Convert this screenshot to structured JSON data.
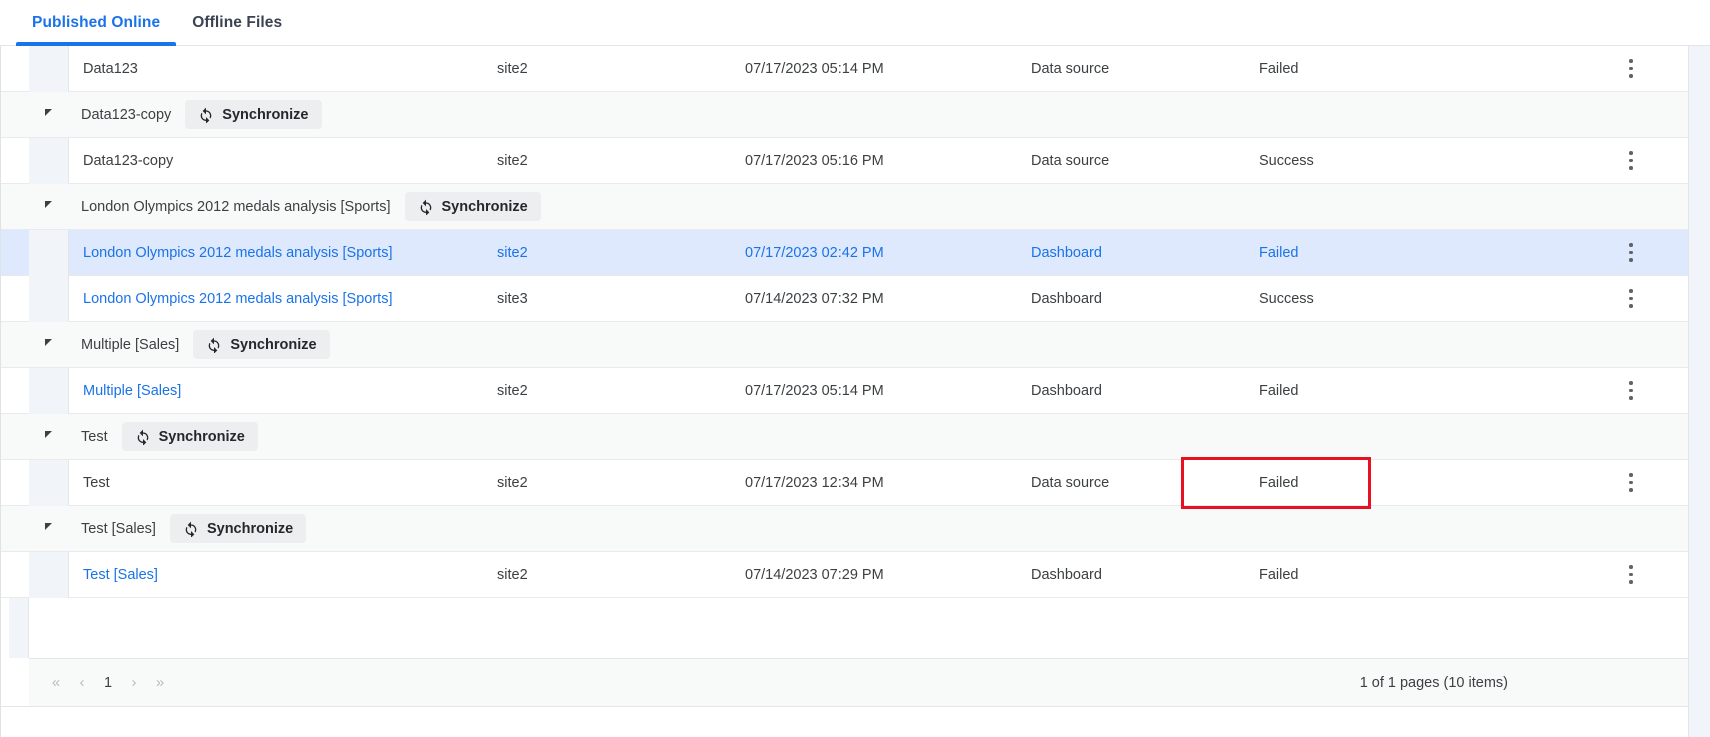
{
  "tabs": [
    {
      "label": "Published Online",
      "active": true
    },
    {
      "label": "Offline Files",
      "active": false
    }
  ],
  "colors": {
    "accent": "#1a73e8",
    "selected_row_bg": "#dee9fd",
    "group_header_bg": "#f8f9f9",
    "annotation_red": "#e81123",
    "text": "#3c4043"
  },
  "sync_button_label": "Synchronize",
  "icons": {
    "expander": "triangle-collapse-icon",
    "sync": "refresh-sync-icon",
    "kebab": "more-vertical-icon",
    "first_page": "chevron-double-left-icon",
    "prev_page": "chevron-left-icon",
    "next_page": "chevron-right-icon",
    "last_page": "chevron-double-right-icon"
  },
  "groups": [
    {
      "header": null,
      "rows": [
        {
          "name": "Data123",
          "name_is_link": false,
          "site": "site2",
          "timestamp": "07/17/2023 05:14 PM",
          "type": "Data source",
          "status": "Failed",
          "selected": false,
          "annotated": false
        }
      ]
    },
    {
      "header": {
        "label": "Data123-copy",
        "sync_label": "Synchronize"
      },
      "rows": [
        {
          "name": "Data123-copy",
          "name_is_link": false,
          "site": "site2",
          "timestamp": "07/17/2023 05:16 PM",
          "type": "Data source",
          "status": "Success",
          "selected": false,
          "annotated": false
        }
      ]
    },
    {
      "header": {
        "label": "London Olympics 2012 medals analysis [Sports]",
        "sync_label": "Synchronize"
      },
      "rows": [
        {
          "name": "London Olympics 2012 medals analysis [Sports]",
          "name_is_link": true,
          "site": "site2",
          "timestamp": "07/17/2023 02:42 PM",
          "type": "Dashboard",
          "status": "Failed",
          "selected": true,
          "annotated": false
        },
        {
          "name": "London Olympics 2012 medals analysis [Sports]",
          "name_is_link": true,
          "site": "site3",
          "timestamp": "07/14/2023 07:32 PM",
          "type": "Dashboard",
          "status": "Success",
          "selected": false,
          "annotated": false
        }
      ]
    },
    {
      "header": {
        "label": "Multiple [Sales]",
        "sync_label": "Synchronize"
      },
      "rows": [
        {
          "name": "Multiple [Sales]",
          "name_is_link": true,
          "site": "site2",
          "timestamp": "07/17/2023 05:14 PM",
          "type": "Dashboard",
          "status": "Failed",
          "selected": false,
          "annotated": false
        }
      ]
    },
    {
      "header": {
        "label": "Test",
        "sync_label": "Synchronize"
      },
      "rows": [
        {
          "name": "Test",
          "name_is_link": false,
          "site": "site2",
          "timestamp": "07/17/2023 12:34 PM",
          "type": "Data source",
          "status": "Failed",
          "selected": false,
          "annotated": true
        }
      ]
    },
    {
      "header": {
        "label": "Test [Sales]",
        "sync_label": "Synchronize"
      },
      "rows": [
        {
          "name": "Test [Sales]",
          "name_is_link": true,
          "site": "site2",
          "timestamp": "07/14/2023 07:29 PM",
          "type": "Dashboard",
          "status": "Failed",
          "selected": false,
          "annotated": false
        }
      ]
    }
  ],
  "pagination": {
    "first_label": "«",
    "prev_label": "‹",
    "current_page": "1",
    "next_label": "›",
    "last_label": "»",
    "page_info": "1 of 1 pages (10 items)"
  }
}
